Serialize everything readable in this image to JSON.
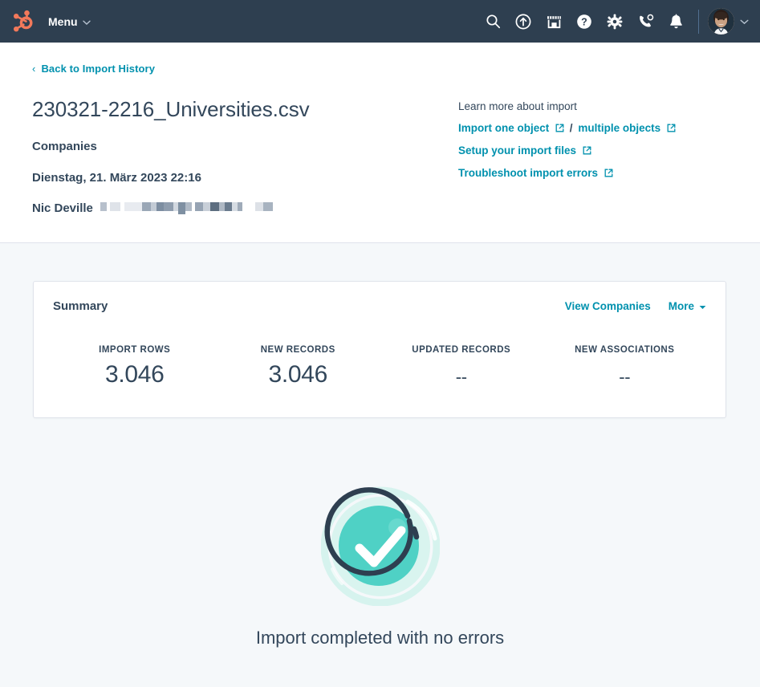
{
  "nav": {
    "logo_icon": "hubspot-sprocket-logo",
    "menu_label": "Menu",
    "icons": [
      {
        "name": "search-icon",
        "label": "Search"
      },
      {
        "name": "upgrade-arrow-icon",
        "label": "Upgrades"
      },
      {
        "name": "marketplace-storefront-icon",
        "label": "Marketplace"
      },
      {
        "name": "help-question-icon",
        "label": "Help"
      },
      {
        "name": "settings-gear-icon",
        "label": "Settings"
      },
      {
        "name": "phone-call-icon",
        "label": "Calling"
      },
      {
        "name": "notifications-bell-icon",
        "label": "Notifications"
      }
    ],
    "avatar_name": "user-avatar",
    "account_caret": "chevron-down-icon"
  },
  "header": {
    "back_link": "Back to Import History",
    "back_icon": "chevron-left-icon",
    "file_name": "230321-2216_Universities.csv",
    "object_type": "Companies",
    "import_date": "Dienstag, 21. März 2023 22:16",
    "user_name": "Nic Deville",
    "user_email_redacted": "redacted-email"
  },
  "learn": {
    "label": "Learn more about import",
    "links": [
      {
        "text": "Import one object",
        "icon": "external-link-icon"
      },
      {
        "text": "multiple objects",
        "icon": "external-link-icon"
      },
      {
        "text": "Setup your import files",
        "icon": "external-link-icon"
      },
      {
        "text": "Troubleshoot import errors",
        "icon": "external-link-icon"
      }
    ],
    "separator": "/"
  },
  "summary": {
    "title": "Summary",
    "view_companies_label": "View Companies",
    "more_label": "More",
    "more_icon": "caret-down-icon",
    "stats": [
      {
        "label": "IMPORT ROWS",
        "value": "3.046"
      },
      {
        "label": "NEW RECORDS",
        "value": "3.046"
      },
      {
        "label": "UPDATED RECORDS",
        "value": "--"
      },
      {
        "label": "NEW ASSOCIATIONS",
        "value": "--"
      }
    ]
  },
  "result": {
    "status_icon": "success-check-circle-icon",
    "message": "Import completed with no errors"
  },
  "colors": {
    "nav_background": "#2e3f50",
    "page_background": "#f5f8fa",
    "card_background": "#ffffff",
    "link_teal": "#0091ae",
    "text_dark": "#33475b",
    "success_teal": "#4fd1c5",
    "success_ring_navy": "#2e3f50",
    "logo_orange": "#f2795b",
    "border": "#dfe3eb"
  }
}
